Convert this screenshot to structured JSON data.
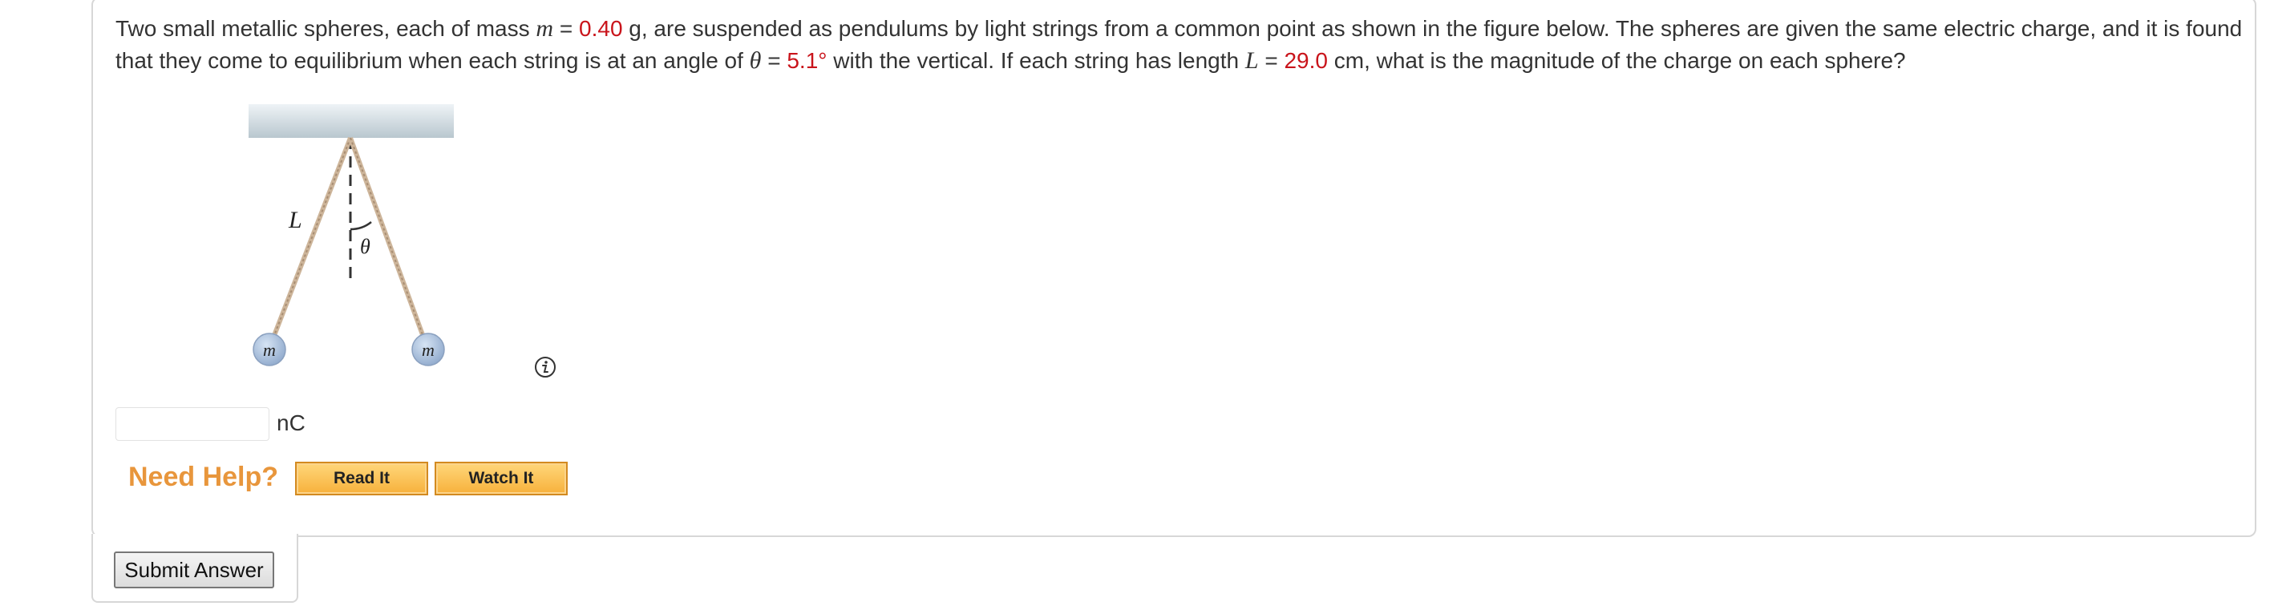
{
  "question": {
    "text_part1": "Two small metallic spheres, each of mass ",
    "mass_var": "m",
    "eq1": " = ",
    "mass_value": "0.40",
    "text_part2": " g, are suspended as pendulums by light strings from a common point as shown in the figure below. The spheres are given the same electric charge, and it is found that they come to equilibrium when each string is at an angle of ",
    "angle_var": "θ",
    "eq2": " = ",
    "angle_value": "5.1°",
    "text_part3": " with the vertical. If each string has length ",
    "length_var": "L",
    "eq3": " = ",
    "length_value": "29.0",
    "text_part4": " cm, what is the magnitude of the charge on each sphere?"
  },
  "figure": {
    "length_label": "L",
    "angle_label": "θ",
    "mass_left_label": "m",
    "mass_right_label": "m"
  },
  "answer": {
    "value": "",
    "unit": "nC"
  },
  "help": {
    "label": "Need Help?",
    "read_it": "Read It",
    "watch_it": "Watch It"
  },
  "submit": {
    "label": "Submit Answer"
  },
  "colors": {
    "value_highlight": "#c9141b",
    "need_help": "#e8963c",
    "button_fill": "#f7b13b"
  }
}
